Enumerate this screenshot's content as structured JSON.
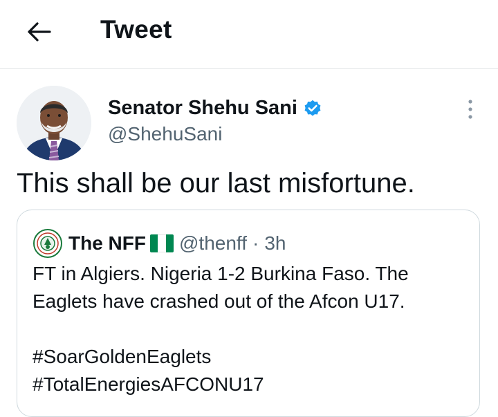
{
  "header": {
    "title": "Tweet"
  },
  "tweet": {
    "author_name": "Senator Shehu Sani",
    "author_handle": "@ShehuSani",
    "text": "This shall be our last misfortune."
  },
  "quote": {
    "name": "The NFF",
    "handle": "@thenff",
    "separator": "·",
    "time": "3h",
    "line1": "FT in Algiers. Nigeria 1-2 Burkina Faso. The",
    "line2": "Eaglets have crashed out of the Afcon U17.",
    "hashtag1": "#SoarGoldenEaglets",
    "hashtag2": "#TotalEnergiesAFCONU17"
  },
  "icons": {
    "back": "arrow-left-icon",
    "verified": "verified-badge-icon",
    "more": "more-vertical-icon",
    "flag": "nigeria-flag-icon",
    "logo": "nff-logo-icon"
  },
  "colors": {
    "verified": "#1d9bf0",
    "secondary_text": "#536471",
    "border": "#cfd9de",
    "flag_green": "#008751",
    "flag_white": "#ffffff"
  }
}
